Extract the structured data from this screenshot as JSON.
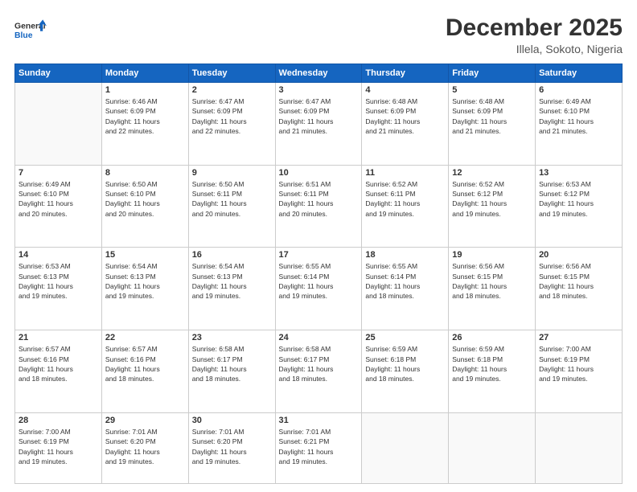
{
  "logo": {
    "line1": "General",
    "line2": "Blue"
  },
  "header": {
    "title": "December 2025",
    "subtitle": "Illela, Sokoto, Nigeria"
  },
  "weekdays": [
    "Sunday",
    "Monday",
    "Tuesday",
    "Wednesday",
    "Thursday",
    "Friday",
    "Saturday"
  ],
  "weeks": [
    [
      {
        "day": "",
        "info": ""
      },
      {
        "day": "1",
        "info": "Sunrise: 6:46 AM\nSunset: 6:09 PM\nDaylight: 11 hours\nand 22 minutes."
      },
      {
        "day": "2",
        "info": "Sunrise: 6:47 AM\nSunset: 6:09 PM\nDaylight: 11 hours\nand 22 minutes."
      },
      {
        "day": "3",
        "info": "Sunrise: 6:47 AM\nSunset: 6:09 PM\nDaylight: 11 hours\nand 21 minutes."
      },
      {
        "day": "4",
        "info": "Sunrise: 6:48 AM\nSunset: 6:09 PM\nDaylight: 11 hours\nand 21 minutes."
      },
      {
        "day": "5",
        "info": "Sunrise: 6:48 AM\nSunset: 6:09 PM\nDaylight: 11 hours\nand 21 minutes."
      },
      {
        "day": "6",
        "info": "Sunrise: 6:49 AM\nSunset: 6:10 PM\nDaylight: 11 hours\nand 21 minutes."
      }
    ],
    [
      {
        "day": "7",
        "info": "Sunrise: 6:49 AM\nSunset: 6:10 PM\nDaylight: 11 hours\nand 20 minutes."
      },
      {
        "day": "8",
        "info": "Sunrise: 6:50 AM\nSunset: 6:10 PM\nDaylight: 11 hours\nand 20 minutes."
      },
      {
        "day": "9",
        "info": "Sunrise: 6:50 AM\nSunset: 6:11 PM\nDaylight: 11 hours\nand 20 minutes."
      },
      {
        "day": "10",
        "info": "Sunrise: 6:51 AM\nSunset: 6:11 PM\nDaylight: 11 hours\nand 20 minutes."
      },
      {
        "day": "11",
        "info": "Sunrise: 6:52 AM\nSunset: 6:11 PM\nDaylight: 11 hours\nand 19 minutes."
      },
      {
        "day": "12",
        "info": "Sunrise: 6:52 AM\nSunset: 6:12 PM\nDaylight: 11 hours\nand 19 minutes."
      },
      {
        "day": "13",
        "info": "Sunrise: 6:53 AM\nSunset: 6:12 PM\nDaylight: 11 hours\nand 19 minutes."
      }
    ],
    [
      {
        "day": "14",
        "info": "Sunrise: 6:53 AM\nSunset: 6:13 PM\nDaylight: 11 hours\nand 19 minutes."
      },
      {
        "day": "15",
        "info": "Sunrise: 6:54 AM\nSunset: 6:13 PM\nDaylight: 11 hours\nand 19 minutes."
      },
      {
        "day": "16",
        "info": "Sunrise: 6:54 AM\nSunset: 6:13 PM\nDaylight: 11 hours\nand 19 minutes."
      },
      {
        "day": "17",
        "info": "Sunrise: 6:55 AM\nSunset: 6:14 PM\nDaylight: 11 hours\nand 19 minutes."
      },
      {
        "day": "18",
        "info": "Sunrise: 6:55 AM\nSunset: 6:14 PM\nDaylight: 11 hours\nand 18 minutes."
      },
      {
        "day": "19",
        "info": "Sunrise: 6:56 AM\nSunset: 6:15 PM\nDaylight: 11 hours\nand 18 minutes."
      },
      {
        "day": "20",
        "info": "Sunrise: 6:56 AM\nSunset: 6:15 PM\nDaylight: 11 hours\nand 18 minutes."
      }
    ],
    [
      {
        "day": "21",
        "info": "Sunrise: 6:57 AM\nSunset: 6:16 PM\nDaylight: 11 hours\nand 18 minutes."
      },
      {
        "day": "22",
        "info": "Sunrise: 6:57 AM\nSunset: 6:16 PM\nDaylight: 11 hours\nand 18 minutes."
      },
      {
        "day": "23",
        "info": "Sunrise: 6:58 AM\nSunset: 6:17 PM\nDaylight: 11 hours\nand 18 minutes."
      },
      {
        "day": "24",
        "info": "Sunrise: 6:58 AM\nSunset: 6:17 PM\nDaylight: 11 hours\nand 18 minutes."
      },
      {
        "day": "25",
        "info": "Sunrise: 6:59 AM\nSunset: 6:18 PM\nDaylight: 11 hours\nand 18 minutes."
      },
      {
        "day": "26",
        "info": "Sunrise: 6:59 AM\nSunset: 6:18 PM\nDaylight: 11 hours\nand 19 minutes."
      },
      {
        "day": "27",
        "info": "Sunrise: 7:00 AM\nSunset: 6:19 PM\nDaylight: 11 hours\nand 19 minutes."
      }
    ],
    [
      {
        "day": "28",
        "info": "Sunrise: 7:00 AM\nSunset: 6:19 PM\nDaylight: 11 hours\nand 19 minutes."
      },
      {
        "day": "29",
        "info": "Sunrise: 7:01 AM\nSunset: 6:20 PM\nDaylight: 11 hours\nand 19 minutes."
      },
      {
        "day": "30",
        "info": "Sunrise: 7:01 AM\nSunset: 6:20 PM\nDaylight: 11 hours\nand 19 minutes."
      },
      {
        "day": "31",
        "info": "Sunrise: 7:01 AM\nSunset: 6:21 PM\nDaylight: 11 hours\nand 19 minutes."
      },
      {
        "day": "",
        "info": ""
      },
      {
        "day": "",
        "info": ""
      },
      {
        "day": "",
        "info": ""
      }
    ]
  ]
}
